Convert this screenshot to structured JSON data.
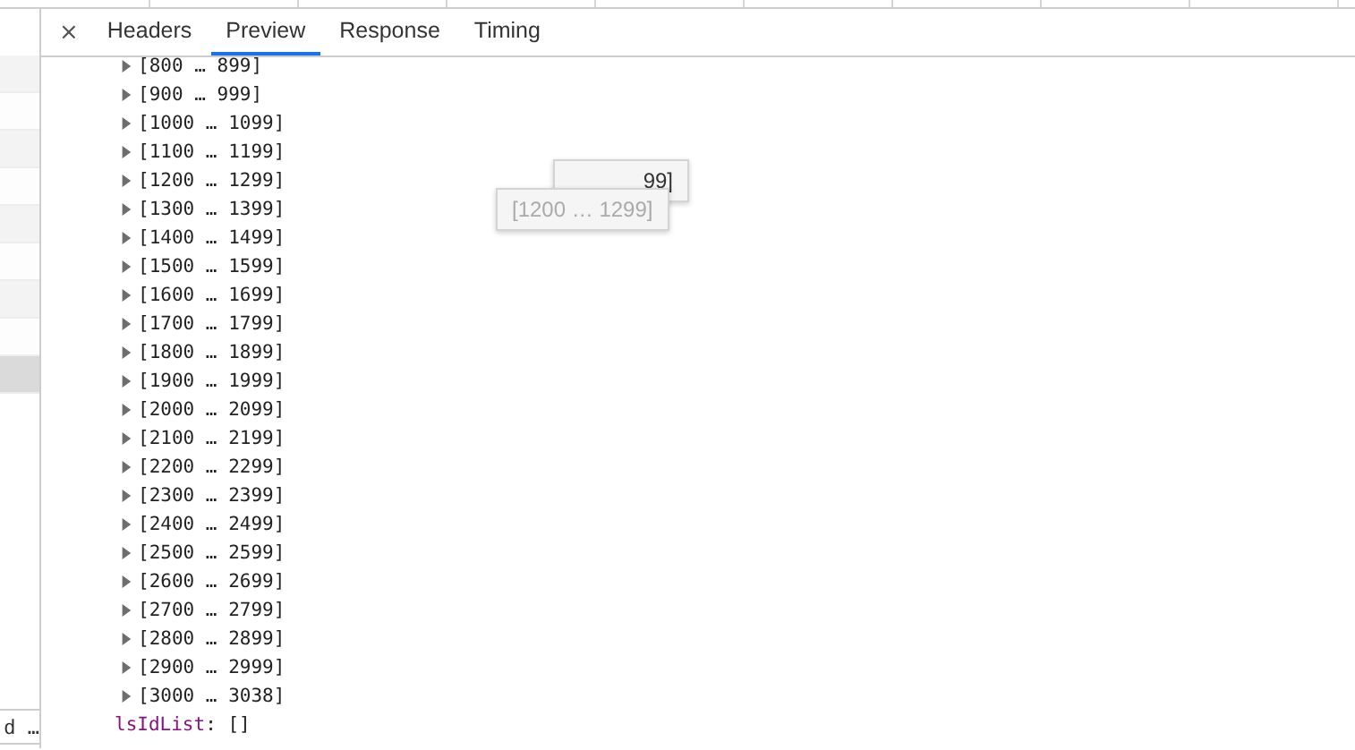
{
  "sidebar": {
    "rows": [
      {
        "selected": false
      },
      {
        "selected": false
      },
      {
        "selected": false
      },
      {
        "selected": false
      },
      {
        "selected": false
      },
      {
        "selected": false
      },
      {
        "selected": false
      },
      {
        "selected": false
      },
      {
        "selected": true
      }
    ],
    "footer_text": "d …"
  },
  "tabs": [
    {
      "label": "Headers",
      "selected": false
    },
    {
      "label": "Preview",
      "selected": true
    },
    {
      "label": "Response",
      "selected": false
    },
    {
      "label": "Timing",
      "selected": false
    }
  ],
  "close_label": "×",
  "tree": {
    "ranges": [
      {
        "label": "[800 … 899]",
        "expanded": false
      },
      {
        "label": "[900 … 999]",
        "expanded": false
      },
      {
        "label": "[1000 … 1099]",
        "expanded": false
      },
      {
        "label": "[1100 … 1199]",
        "expanded": false
      },
      {
        "label": "[1200 … 1299]",
        "expanded": false
      },
      {
        "label": "[1300 … 1399]",
        "expanded": false
      },
      {
        "label": "[1400 … 1499]",
        "expanded": false
      },
      {
        "label": "[1500 … 1599]",
        "expanded": false
      },
      {
        "label": "[1600 … 1699]",
        "expanded": false
      },
      {
        "label": "[1700 … 1799]",
        "expanded": false
      },
      {
        "label": "[1800 … 1899]",
        "expanded": false
      },
      {
        "label": "[1900 … 1999]",
        "expanded": false
      },
      {
        "label": "[2000 … 2099]",
        "expanded": false
      },
      {
        "label": "[2100 … 2199]",
        "expanded": false
      },
      {
        "label": "[2200 … 2299]",
        "expanded": false
      },
      {
        "label": "[2300 … 2399]",
        "expanded": false
      },
      {
        "label": "[2400 … 2499]",
        "expanded": false
      },
      {
        "label": "[2500 … 2599]",
        "expanded": false
      },
      {
        "label": "[2600 … 2699]",
        "expanded": false
      },
      {
        "label": "[2700 … 2799]",
        "expanded": false
      },
      {
        "label": "[2800 … 2899]",
        "expanded": false
      },
      {
        "label": "[2900 … 2999]",
        "expanded": false
      },
      {
        "label": "[3000 … 3038]",
        "expanded": false
      }
    ],
    "property": {
      "key": "lsIdList",
      "value": ": []"
    }
  },
  "tooltips": [
    {
      "text": "99]"
    },
    {
      "text": "[1200 … 1299]"
    }
  ]
}
